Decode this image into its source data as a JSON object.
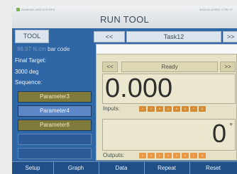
{
  "status": {
    "left": "BLINKING MSG 0.00 RPD",
    "right": "2024-05-13 RDY CTRL 07"
  },
  "header": {
    "title": "RUN TOOL",
    "tool_label": "TOOL",
    "prev_task_label": "<<",
    "task_name": "Task12",
    "next_task_label": ">>"
  },
  "left": {
    "torque_reading": "98.97 N.cm",
    "barcode_label": "bar code",
    "final_target_label": "Final Target:",
    "final_target_value": "3000 deg",
    "sequence_label": "Sequence:",
    "parameters": [
      "Parameter3",
      "Parameter4",
      "Parameter8"
    ]
  },
  "panel": {
    "prev_label": "<<",
    "status": "Ready",
    "next_label": ">>",
    "torque_value": "0.000",
    "inputs_label": "Inputs:",
    "input_dots": [
      "1",
      "2",
      "3",
      "4",
      "5",
      "6",
      "7",
      "8"
    ],
    "angle_value": "0",
    "degree_symbol": "°",
    "outputs_label": "Outputs:",
    "output_dots": [
      "1",
      "2",
      "3",
      "4",
      "5",
      "6",
      "7",
      "8"
    ]
  },
  "bottom_nav": [
    "Setup",
    "Graph",
    "Data",
    "Repeat",
    "Reset"
  ]
}
